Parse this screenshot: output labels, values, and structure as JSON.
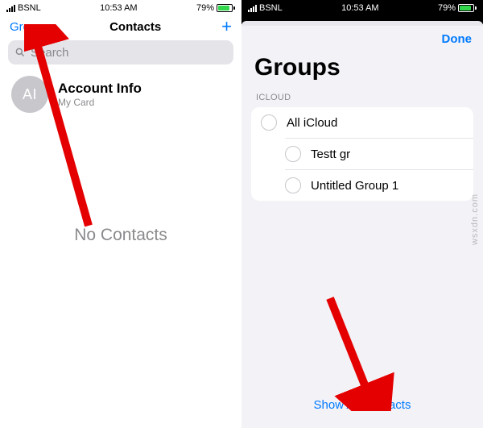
{
  "status": {
    "carrier": "BSNL",
    "time": "10:53 AM",
    "battery": "79%"
  },
  "screen1": {
    "groups_label": "Groups",
    "title": "Contacts",
    "search_placeholder": "Search",
    "avatar_initials": "AI",
    "contact_name": "Account Info",
    "contact_sub": "My Card",
    "empty_text": "No Contacts"
  },
  "screen2": {
    "done_label": "Done",
    "title": "Groups",
    "section": "ICLOUD",
    "items": [
      {
        "label": "All iCloud"
      },
      {
        "label": "Testt gr"
      },
      {
        "label": "Untitled Group 1"
      }
    ],
    "show_all": "Show All Contacts"
  },
  "watermark": "wsxdn.com"
}
